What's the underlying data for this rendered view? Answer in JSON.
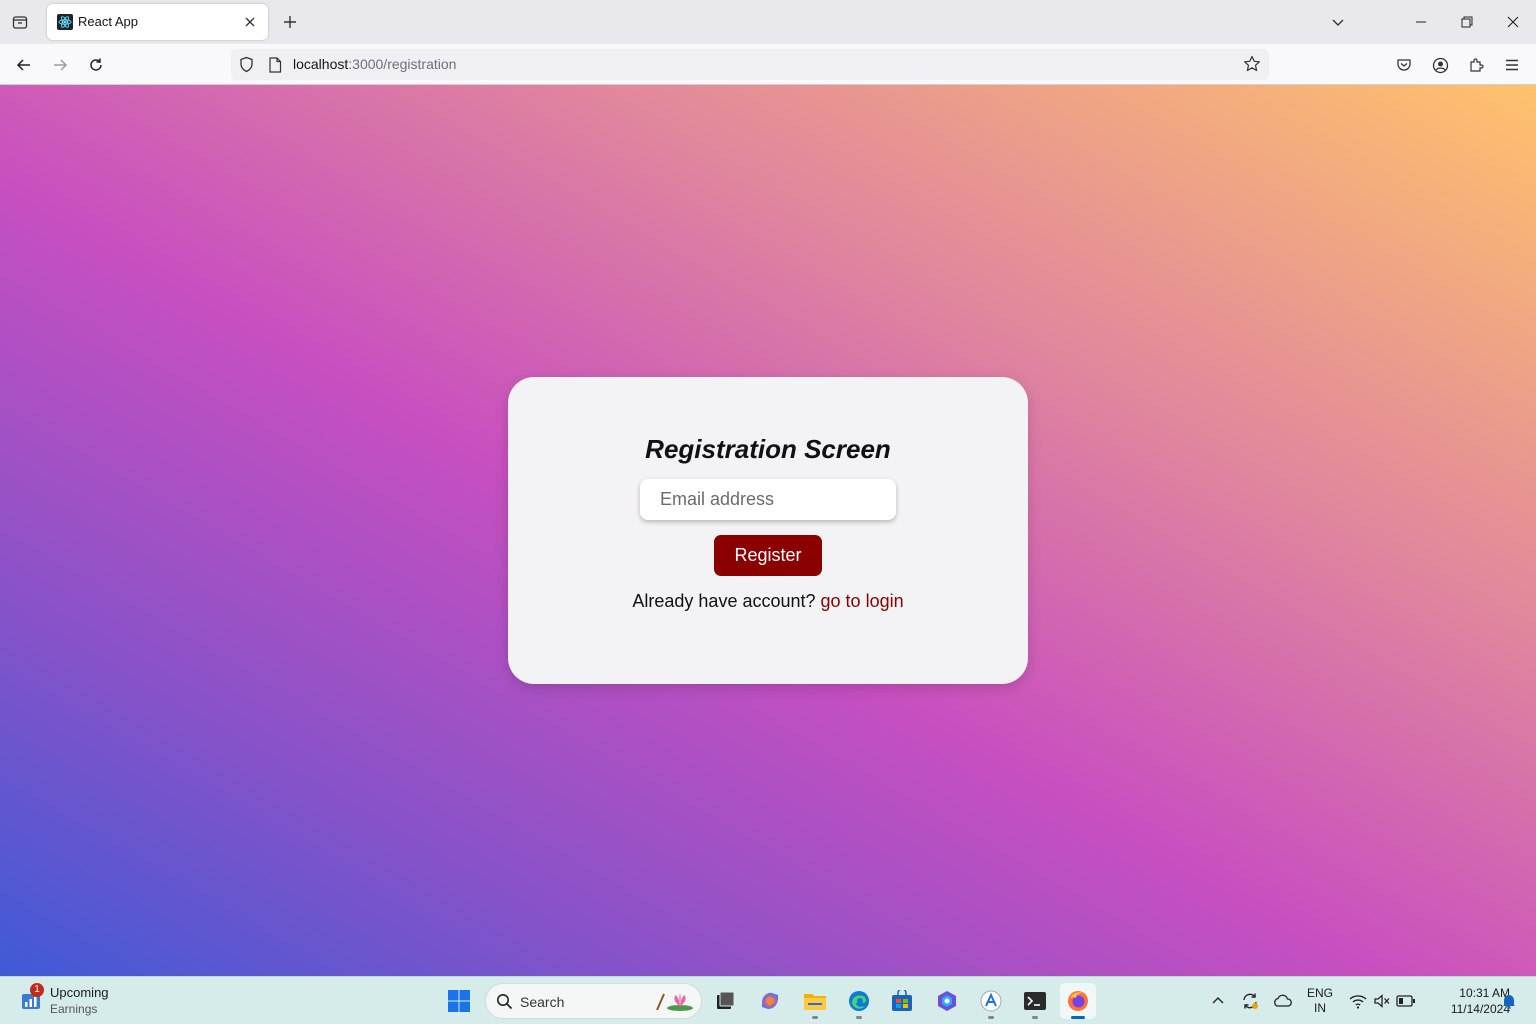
{
  "browser": {
    "tab_title": "React App",
    "url_host": "localhost",
    "url_path": ":3000/registration"
  },
  "registration": {
    "title": "Registration Screen",
    "email_placeholder": "Email address",
    "email_value": "",
    "register_label": "Register",
    "login_prompt": "Already have account?",
    "login_link": "go to login"
  },
  "taskbar": {
    "widget_badge": "1",
    "widget_title": "Upcoming",
    "widget_subtitle": "Earnings",
    "search_label": "Search",
    "language_line1": "ENG",
    "language_line2": "IN",
    "time": "10:31 AM",
    "date": "11/14/2024",
    "apps": [
      "task-view",
      "copilot",
      "file-explorer",
      "edge",
      "store",
      "photos",
      "app-a",
      "terminal",
      "firefox"
    ]
  },
  "colors": {
    "accent_red": "#8b0000",
    "gradient": [
      "#3f5ad6",
      "#8a52c8",
      "#c84fc0",
      "#e1889c",
      "#fec26c"
    ]
  }
}
